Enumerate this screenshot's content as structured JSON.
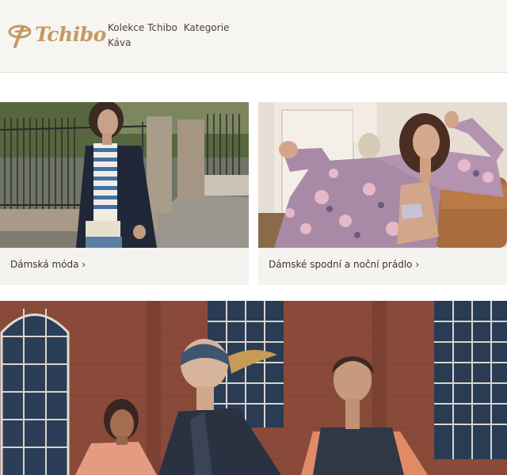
{
  "header": {
    "logo_text": "Tchibo",
    "nav": [
      "Kolekce Tchibo",
      "Kategorie",
      "Káva"
    ]
  },
  "tiles": [
    {
      "label": "Dámská móda ›",
      "image": "woman-in-navy-coat-photo"
    },
    {
      "label": "Dámské spodní a noční prádlo ›",
      "image": "woman-in-floral-pajamas-photo"
    }
  ],
  "hero": {
    "image": "runners-in-front-of-brick-building-photo"
  },
  "colors": {
    "brand_gold": "#c49a62",
    "header_bg": "#f7f5f1",
    "tile_bg": "#f5f3ef",
    "brick": "#8a4a3a"
  }
}
